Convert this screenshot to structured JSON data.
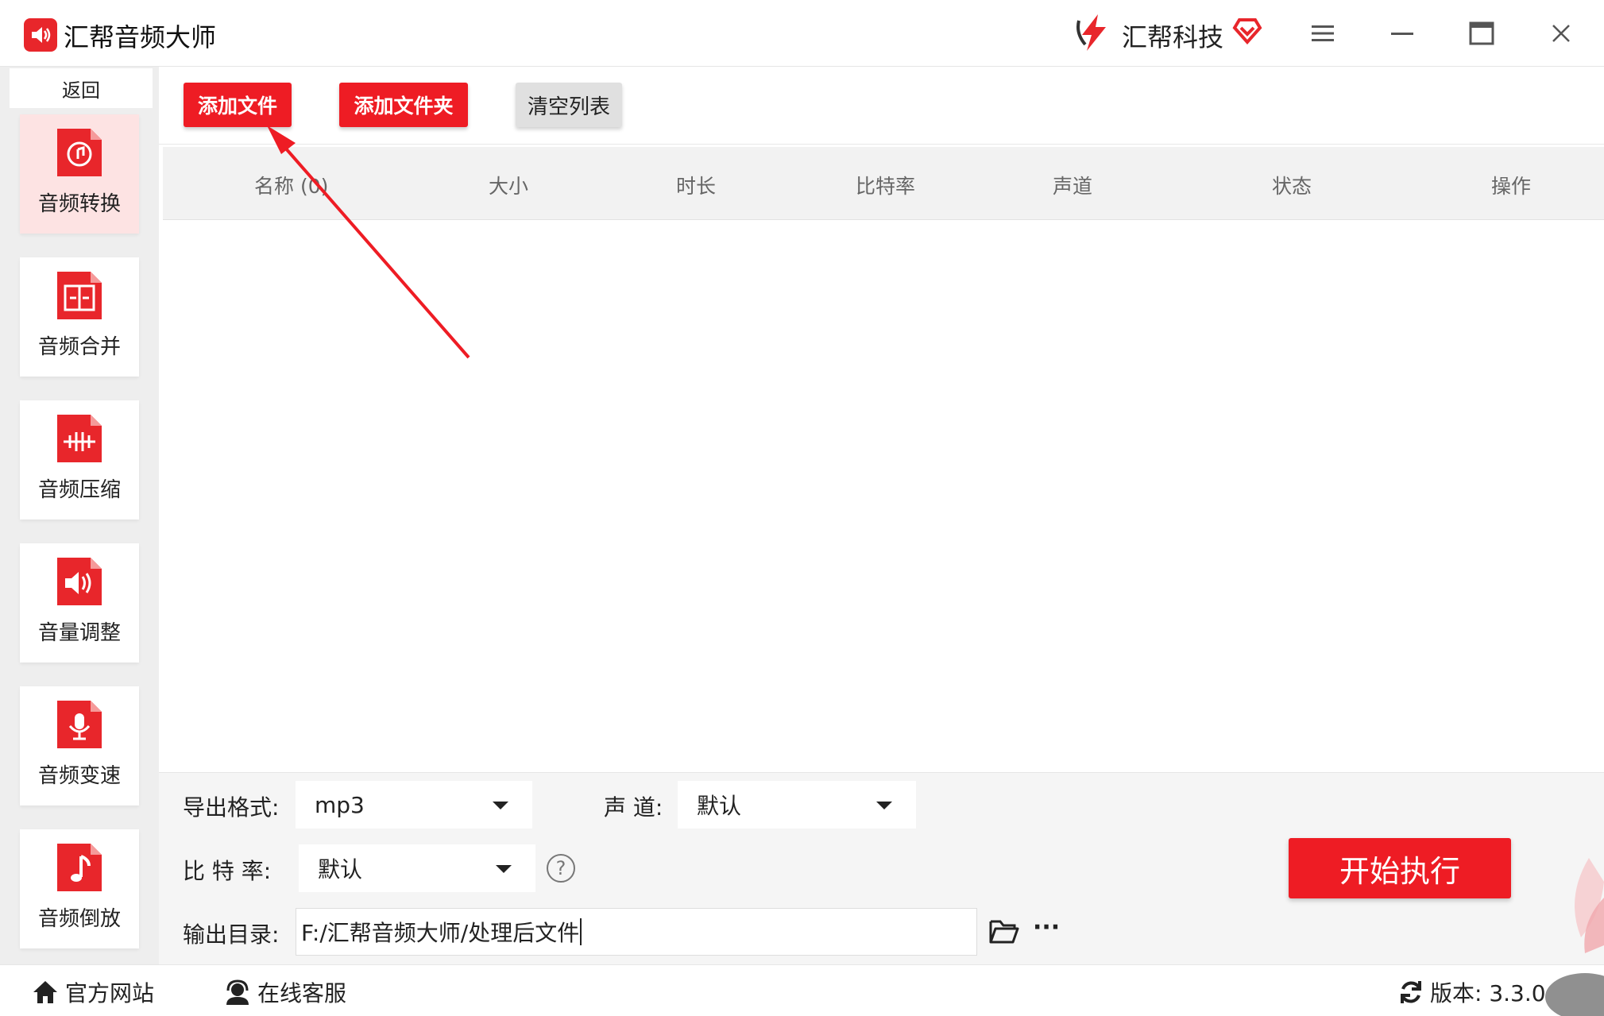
{
  "app": {
    "title": "汇帮音频大师",
    "brand_name": "汇帮科技",
    "accent_color": "#ee1c24",
    "icons": [
      "speaker-logo-icon",
      "brand-logo-icon",
      "vip-heart-icon",
      "menu-icon",
      "minimize-icon",
      "maximize-icon",
      "close-icon"
    ]
  },
  "sidebar": {
    "back_label": "返回",
    "items": [
      {
        "label": "音频转换",
        "icon": "audio-convert-icon",
        "active": true
      },
      {
        "label": "音频合并",
        "icon": "audio-merge-icon",
        "active": false
      },
      {
        "label": "音频压缩",
        "icon": "audio-compress-icon",
        "active": false
      },
      {
        "label": "音量调整",
        "icon": "volume-adjust-icon",
        "active": false
      },
      {
        "label": "音频变速",
        "icon": "audio-speed-icon",
        "active": false
      },
      {
        "label": "音频倒放",
        "icon": "audio-reverse-icon",
        "active": false
      }
    ]
  },
  "toolbar": {
    "add_file": "添加文件",
    "add_folder": "添加文件夹",
    "clear_list": "清空列表"
  },
  "table": {
    "columns": [
      "名称 (0)",
      "大小",
      "时长",
      "比特率",
      "声道",
      "状态",
      "操作"
    ],
    "rows": []
  },
  "settings": {
    "format_label": "导出格式:",
    "format_value": "mp3",
    "channel_label": "声 道:",
    "channel_value": "默认",
    "bitrate_label": "比 特 率:",
    "bitrate_value": "默认",
    "help_glyph": "?",
    "output_label": "输出目录:",
    "output_path": "F:/汇帮音频大师/处理后文件",
    "more_glyph": "···",
    "start_label": "开始执行"
  },
  "footer": {
    "website": "官方网站",
    "support": "在线客服",
    "version": "版本: 3.3.0"
  }
}
